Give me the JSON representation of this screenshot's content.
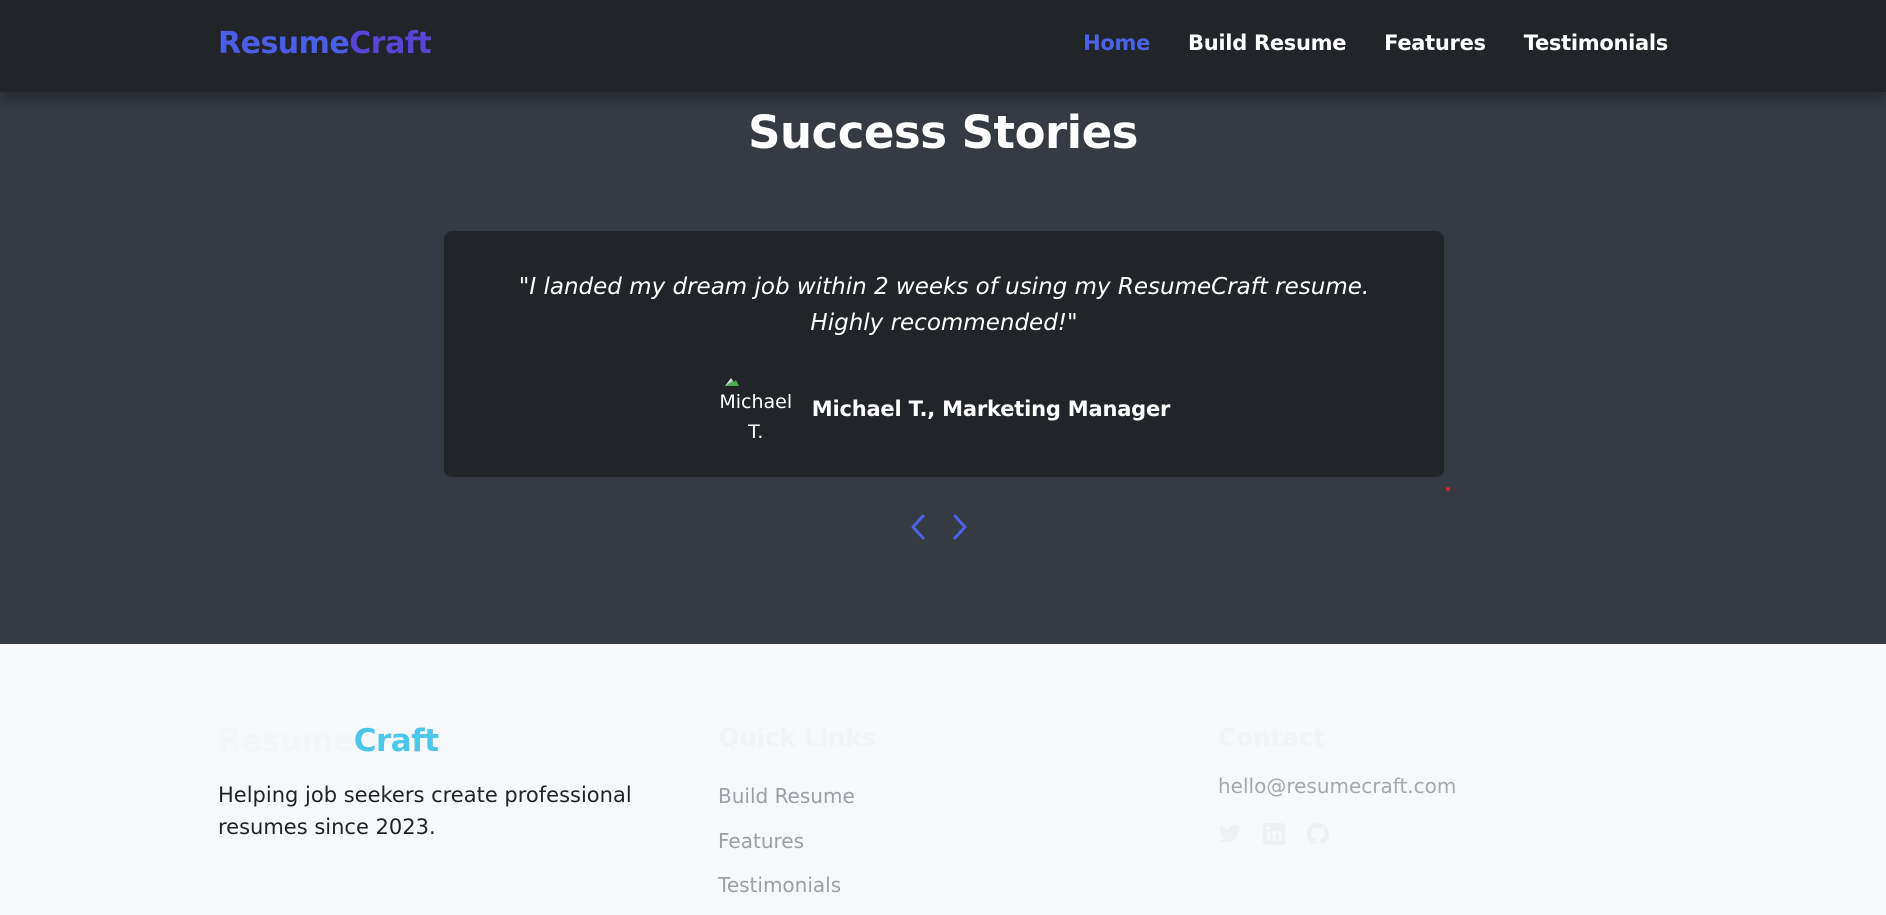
{
  "nav": {
    "brand_part1": "Resume",
    "brand_part2": "Craft",
    "links": [
      "Home",
      "Build Resume",
      "Features",
      "Testimonials"
    ],
    "active": "Home"
  },
  "testimonials": {
    "title": "Success Stories",
    "quote": "\"I landed my dream job within 2 weeks of using my ResumeCraft resume. Highly recommended!\"",
    "avatar_alt": "Michael T.",
    "author": "Michael T., Marketing Manager",
    "controls": {
      "prev": "chevron-left-icon",
      "next": "chevron-right-icon"
    }
  },
  "footer": {
    "brand_part1": "Resume",
    "brand_part2": "Craft",
    "tagline": "Helping job seekers create professional resumes since 2023.",
    "quick_links_heading": "Quick Links",
    "quick_links": [
      "Build Resume",
      "Features",
      "Testimonials"
    ],
    "contact_heading": "Contact",
    "email": "hello@resumecraft.com",
    "socials": [
      "twitter-icon",
      "linkedin-icon",
      "github-icon"
    ]
  },
  "colors": {
    "accent": "#4a63ea",
    "navbar_bg": "#212428",
    "hero_bg": "#363a43",
    "card_bg": "#212428",
    "footer_bg": "#f7f8f9",
    "footer_brand_accent": "#4cc6ea"
  }
}
